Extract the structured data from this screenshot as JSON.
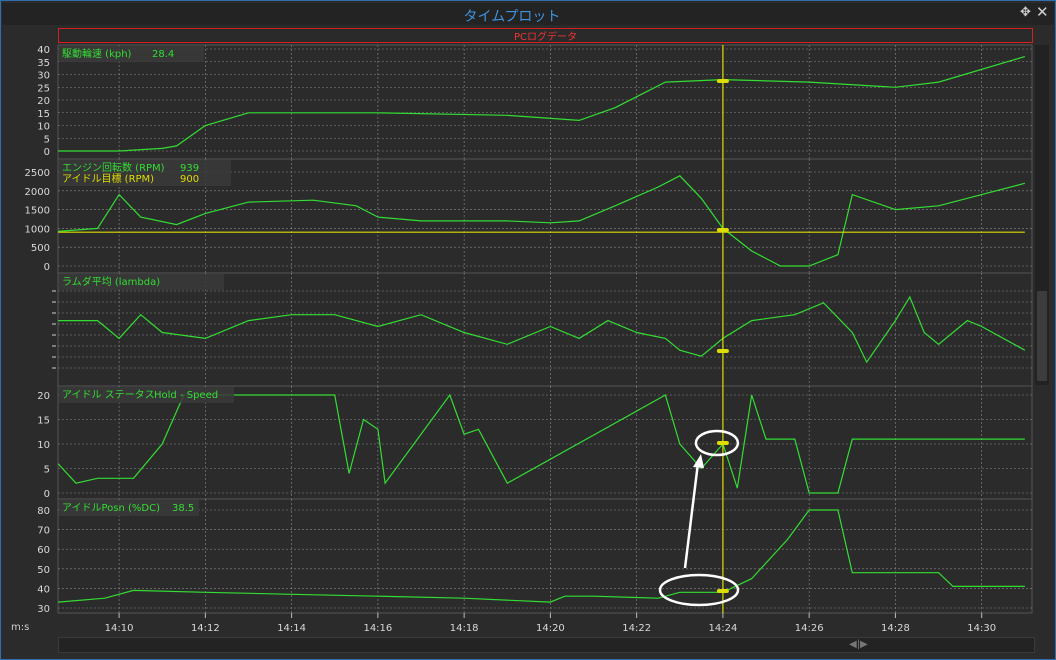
{
  "window": {
    "title": "タイムプロット",
    "move_glyph": "✥",
    "close_glyph": "✕"
  },
  "subtitle": "PCログデータ",
  "time_axis": {
    "unit_label": "m:s",
    "ticks": [
      "14:10",
      "14:12",
      "14:14",
      "14:16",
      "14:18",
      "14:20",
      "14:22",
      "14:24",
      "14:26",
      "14:28",
      "14:30"
    ]
  },
  "colors": {
    "series": "#33dd33",
    "cursor": "#dddd00",
    "grid": "#8a8a8a",
    "plot_bg": "#2b2b2b",
    "legend_bg": "#3a3a3a",
    "annotation": "#ffffff"
  },
  "annotations": {
    "arrow": true,
    "ellipses": 2
  },
  "chart_data": [
    {
      "type": "line",
      "legend": [
        {
          "label": "駆動輪速 (kph)",
          "value": "28.4"
        }
      ],
      "ylim": [
        0,
        40
      ],
      "yticks": [
        "40",
        "35",
        "30",
        "25",
        "20",
        "15",
        "10",
        "5",
        "0"
      ],
      "x": [
        "14:08:35",
        "14:10:00",
        "14:11:00",
        "14:11:20",
        "14:12:00",
        "14:13:00",
        "14:16:00",
        "14:19:00",
        "14:20:40",
        "14:21:30",
        "14:22:40",
        "14:24:00",
        "14:26:00",
        "14:28:00",
        "14:29:00",
        "14:31:00"
      ],
      "values": [
        0,
        0,
        1,
        2,
        10,
        15,
        15,
        14,
        12,
        17,
        27,
        28,
        27,
        25,
        27,
        37
      ],
      "cursor_value": 28.4
    },
    {
      "type": "line",
      "legend": [
        {
          "label": "エンジン回転数 (RPM)",
          "value": "939"
        },
        {
          "label": "アイドル目標 (RPM)",
          "value": "900"
        }
      ],
      "ylim": [
        0,
        2500
      ],
      "yticks": [
        "2500",
        "2000",
        "1500",
        "1000",
        "500",
        "0"
      ],
      "series": [
        {
          "name": "エンジン回転数 (RPM)",
          "x": [
            "14:08:35",
            "14:09:30",
            "14:10:00",
            "14:10:30",
            "14:11:20",
            "14:12:00",
            "14:13:00",
            "14:14:30",
            "14:15:30",
            "14:16:00",
            "14:17:00",
            "14:19:00",
            "14:20:00",
            "14:20:40",
            "14:21:30",
            "14:22:30",
            "14:23:00",
            "14:23:30",
            "14:24:00",
            "14:24:40",
            "14:25:20",
            "14:26:00",
            "14:26:40",
            "14:27:00",
            "14:28:00",
            "14:29:00",
            "14:30:00",
            "14:31:00"
          ],
          "values": [
            920,
            1000,
            1900,
            1300,
            1100,
            1400,
            1700,
            1750,
            1600,
            1300,
            1200,
            1200,
            1150,
            1200,
            1600,
            2100,
            2400,
            1800,
            1000,
            400,
            0,
            0,
            300,
            1900,
            1500,
            1600,
            1900,
            2200
          ]
        },
        {
          "name": "アイドル目標 (RPM)",
          "x": [
            "14:08:35",
            "14:31:00"
          ],
          "values": [
            900,
            900
          ]
        }
      ]
    },
    {
      "type": "line",
      "legend": [
        {
          "label": "ラムダ平均 (lambda)",
          "value": ""
        }
      ],
      "yticks": [],
      "x": [
        "14:08:35",
        "14:09:30",
        "14:09:40",
        "14:10:00",
        "14:10:30",
        "14:11:00",
        "14:12:00",
        "14:13:00",
        "14:14:00",
        "14:15:00",
        "14:16:00",
        "14:17:00",
        "14:18:00",
        "14:19:00",
        "14:20:00",
        "14:20:40",
        "14:21:20",
        "14:22:00",
        "14:22:40",
        "14:23:00",
        "14:23:30",
        "14:24:00",
        "14:24:40",
        "14:25:40",
        "14:26:20",
        "14:27:00",
        "14:27:20",
        "14:28:00",
        "14:28:20",
        "14:28:40",
        "14:29:00",
        "14:29:40",
        "14:30:00",
        "14:31:00"
      ],
      "values": [
        0.5,
        0.5,
        0.4,
        0.2,
        0.6,
        0.3,
        0.2,
        0.5,
        0.6,
        0.6,
        0.4,
        0.6,
        0.3,
        0.1,
        0.4,
        0.2,
        0.5,
        0.3,
        0.2,
        0.0,
        -0.1,
        0.2,
        0.5,
        0.6,
        0.8,
        0.3,
        -0.2,
        0.5,
        0.9,
        0.3,
        0.1,
        0.5,
        0.4,
        0.0
      ]
    },
    {
      "type": "line",
      "legend": [
        {
          "label": "アイドル ステータス",
          "value": "Hold - Speed"
        }
      ],
      "ylim": [
        0,
        20
      ],
      "yticks": [
        "20",
        "15",
        "10",
        "5",
        "0"
      ],
      "x": [
        "14:08:35",
        "14:09:00",
        "14:09:30",
        "14:10:20",
        "14:11:00",
        "14:11:30",
        "14:15:00",
        "14:15:20",
        "14:15:40",
        "14:16:00",
        "14:16:10",
        "14:17:40",
        "14:18:00",
        "14:18:20",
        "14:19:00",
        "14:22:40",
        "14:23:00",
        "14:23:30",
        "14:24:00",
        "14:24:20",
        "14:24:40",
        "14:25:00",
        "14:25:40",
        "14:26:00",
        "14:26:40",
        "14:27:00",
        "14:31:00"
      ],
      "values": [
        6,
        2,
        3,
        3,
        10,
        20,
        20,
        4,
        15,
        13,
        2,
        20,
        12,
        13,
        2,
        20,
        10,
        5,
        10,
        1,
        20,
        11,
        11,
        0,
        0,
        11,
        11
      ]
    },
    {
      "type": "line",
      "legend": [
        {
          "label": "アイドルPosn (%DC)",
          "value": "38.5"
        }
      ],
      "ylim": [
        30,
        80
      ],
      "yticks": [
        "80",
        "70",
        "60",
        "50",
        "40",
        "30"
      ],
      "x": [
        "14:08:35",
        "14:09:40",
        "14:10:20",
        "14:12:00",
        "14:14:00",
        "14:16:00",
        "14:18:00",
        "14:20:00",
        "14:20:20",
        "14:21:00",
        "14:22:30",
        "14:23:00",
        "14:24:00",
        "14:24:40",
        "14:25:30",
        "14:26:00",
        "14:26:40",
        "14:27:00",
        "14:29:00",
        "14:29:20",
        "14:31:00"
      ],
      "values": [
        33,
        35,
        39,
        38,
        37,
        36,
        35,
        33,
        36,
        36,
        35,
        38,
        38,
        45,
        65,
        80,
        80,
        48,
        48,
        41,
        41
      ],
      "cursor_value": 38.5
    }
  ]
}
